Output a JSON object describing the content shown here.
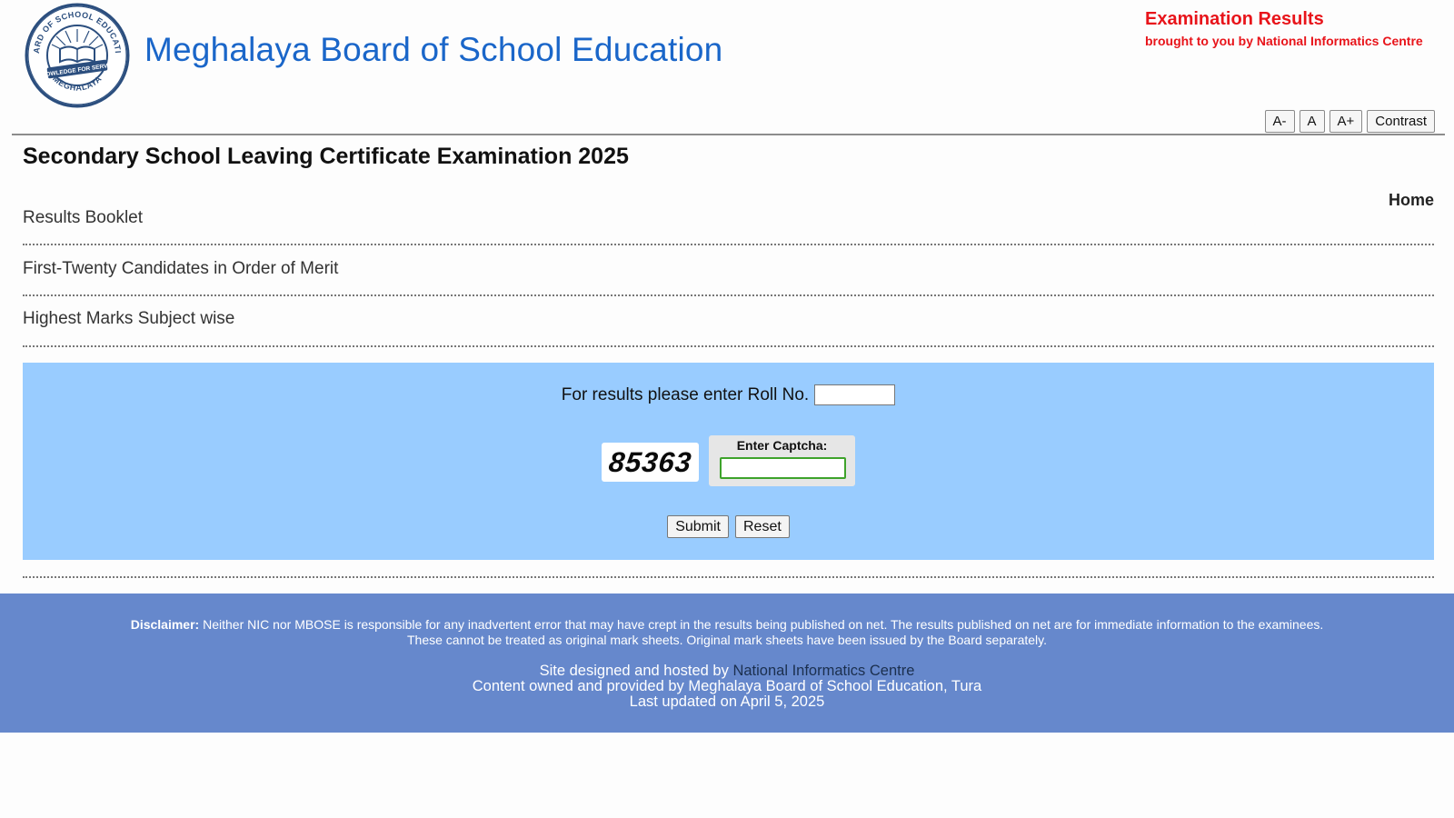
{
  "header": {
    "site_title": "Meghalaya Board of School Education",
    "exam_results": "Examination Results",
    "nic_credit": "brought to you by National Informatics Centre",
    "logo": {
      "ring_top": "BOARD OF SCHOOL EDUCATION",
      "ribbon": "KNOWLEDGE FOR SERVICE",
      "ring_bottom": "MEGHALAYA",
      "color": "#2b4e7e"
    }
  },
  "accessibility": {
    "decrease": "A-",
    "normal": "A",
    "increase": "A+",
    "contrast": "Contrast"
  },
  "page": {
    "exam_title": "Secondary School Leaving Certificate Examination 2025",
    "home": "Home"
  },
  "menu": [
    {
      "label": "Results Booklet"
    },
    {
      "label": "First-Twenty Candidates in Order of Merit"
    },
    {
      "label": "Highest Marks Subject wise"
    }
  ],
  "form": {
    "roll_label": "For results please enter Roll No.",
    "roll_value": "",
    "captcha_code": "85363",
    "captcha_label": "Enter Captcha:",
    "captcha_value": "",
    "submit": "Submit",
    "reset": "Reset",
    "panel_color": "#99ccff"
  },
  "footer": {
    "disclaimer_label": "Disclaimer:",
    "disclaimer_line1": "Neither NIC nor MBOSE is responsible for any inadvertent error that may have crept in the results being published on net. The results published on net are for immediate information to the examinees.",
    "disclaimer_line2": "These cannot be treated as original mark sheets. Original mark sheets have been issued by the Board separately.",
    "hosted_prefix": "Site designed and hosted by",
    "hosted_link": "National Informatics Centre",
    "content_owner": "Content owned and provided by Meghalaya Board of School Education, Tura",
    "last_updated": "Last updated on April 5, 2025",
    "bg_color": "#6688cc"
  }
}
